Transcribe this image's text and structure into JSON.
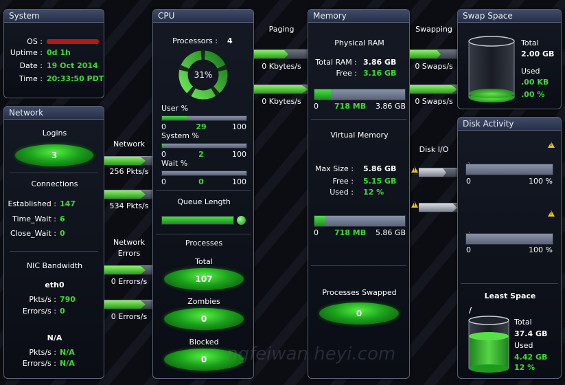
{
  "system": {
    "title": "System",
    "os_label": "OS :",
    "uptime_label": "Uptime :",
    "uptime_value": "0d 1h",
    "date_label": "Date :",
    "date_value": "19 Oct 2014",
    "time_label": "Time :",
    "time_value": "20:33:50 PDT"
  },
  "network": {
    "title": "Network",
    "logins_label": "Logins",
    "logins_value": "3",
    "connections_label": "Connections",
    "established_label": "Established :",
    "established_value": "147",
    "timewait_label": "Time_Wait :",
    "timewait_value": "6",
    "closewait_label": "Close_Wait :",
    "closewait_value": "0",
    "nic_label": "NIC Bandwidth",
    "eth0_label": "eth0",
    "eth0_pkts_label": "Pkts/s :",
    "eth0_pkts_value": "790",
    "eth0_err_label": "Errors/s :",
    "eth0_err_value": "0",
    "na_label": "N/A",
    "na_pkts_label": "Pkts/s :",
    "na_pkts_value": "N/A",
    "na_err_label": "Errors/s :",
    "na_err_value": "N/A"
  },
  "connectors": {
    "network_label": "Network",
    "network_in": "256 Pkts/s",
    "network_out": "534 Pkts/s",
    "errors_label_1": "Network",
    "errors_label_2": "Errors",
    "errors_in": "0 Errors/s",
    "errors_out": "0 Errors/s",
    "paging_label": "Paging",
    "paging_in": "0 Kbytes/s",
    "paging_out": "0 Kbytes/s",
    "swapping_label": "Swapping",
    "swap_in": "0 Swaps/s",
    "swap_out": "0 Swaps/s",
    "diskio_label": "Disk I/O"
  },
  "cpu": {
    "title": "CPU",
    "processors_label": "Processors :",
    "processors_value": "4",
    "gauge_value": "31%",
    "gauge_fraction": 0.31,
    "user_label": "User %",
    "user_value": "29",
    "user_fraction": 0.29,
    "system_label": "System %",
    "system_value": "2",
    "system_fraction": 0.02,
    "wait_label": "Wait %",
    "wait_value": "0",
    "wait_fraction": 0.0,
    "scale_min": "0",
    "scale_max": "100",
    "queue_label": "Queue Length",
    "processes_label": "Processes",
    "total_label": "Total",
    "total_value": "107",
    "zombies_label": "Zombies",
    "zombies_value": "0",
    "blocked_label": "Blocked",
    "blocked_value": "0"
  },
  "memory": {
    "title": "Memory",
    "physical_label": "Physical RAM",
    "total_ram_label": "Total RAM :",
    "total_ram_value": "3.86 GB",
    "free_label": "Free :",
    "free_value": "3.16 GB",
    "phys_min": "0",
    "phys_used": "718 MB",
    "phys_max": "3.86 GB",
    "phys_fraction": 0.18,
    "virtual_label": "Virtual Memory",
    "max_size_label": "Max Size :",
    "max_size_value": "5.86 GB",
    "vfree_label": "Free :",
    "vfree_value": "5.15 GB",
    "used_label": "Used :",
    "used_value": "12 %",
    "virt_min": "0",
    "virt_used": "718 MB",
    "virt_max": "5.86 GB",
    "virt_fraction": 0.12,
    "swapped_label": "Processes Swapped",
    "swapped_value": "0"
  },
  "swap": {
    "title": "Swap Space",
    "total_label": "Total",
    "total_value": "2.00 GB",
    "used_label": "Used",
    "used_value": ".00 KB",
    "used_pct": ".00 %"
  },
  "disk": {
    "title": "Disk Activity",
    "min1": "0",
    "max1": "100 %",
    "min2": "0",
    "max2": "100 %",
    "least_label": "Least Space",
    "mount": "/",
    "total_label": "Total",
    "total_value": "37.4 GB",
    "used_label": "Used",
    "used_value": "4.42 GB",
    "used_pct": "12 %"
  },
  "watermark": "ngfeiwan  heyi.com"
}
